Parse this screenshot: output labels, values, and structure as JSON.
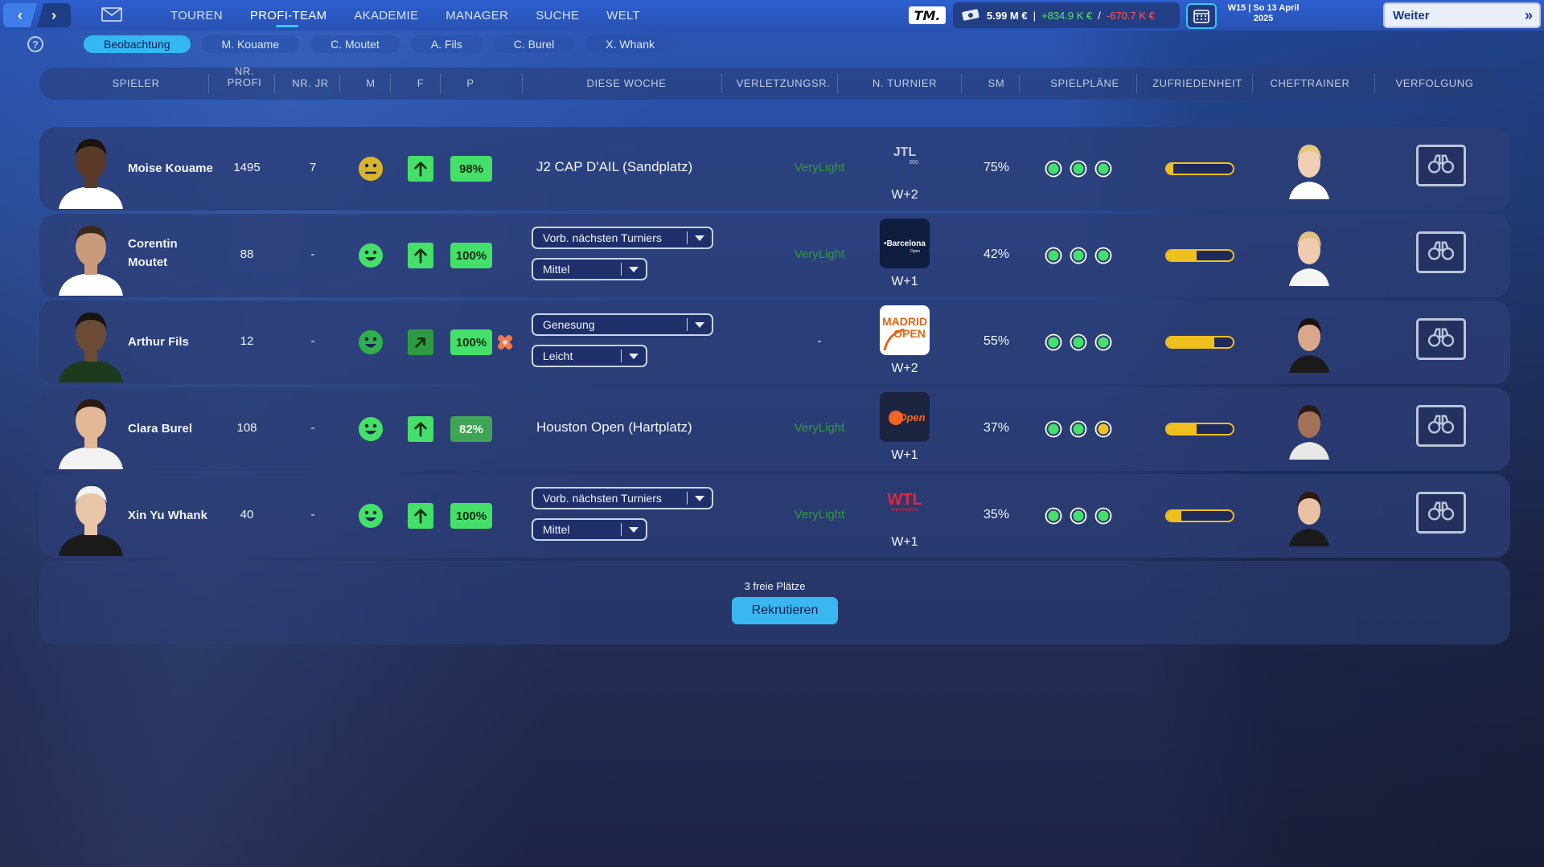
{
  "nav": {
    "back_label": "‹",
    "forward_label": "›",
    "items": [
      {
        "label": "TOUREN"
      },
      {
        "label": "PROFI-TEAM"
      },
      {
        "label": "AKADEMIE"
      },
      {
        "label": "MANAGER"
      },
      {
        "label": "SUCHE"
      },
      {
        "label": "WELT"
      }
    ],
    "active": "PROFI-TEAM"
  },
  "status": {
    "logo": "TM.",
    "balance": "5.99 M €",
    "separator": "|",
    "income": "+834.9 K €",
    "slash": "/",
    "expense": "-670.7 K €",
    "date_line1": "W15 | So 13 April",
    "date_line2": "2025",
    "continue_label": "Weiter",
    "continue_chevron": "»"
  },
  "help": "?",
  "subtabs": [
    {
      "label": "Beobachtung"
    },
    {
      "label": "M. Kouame"
    },
    {
      "label": "C. Moutet"
    },
    {
      "label": "A. Fils"
    },
    {
      "label": "C. Burel"
    },
    {
      "label": "X. Whank"
    }
  ],
  "columns": {
    "spieler": "SPIELER",
    "nr_profi": "NR.\nPROFI",
    "nr_jr": "NR. JR",
    "m": "M",
    "f": "F",
    "p": "P",
    "diese_woche": "DIESE WOCHE",
    "verletzung": "VERLETZUNGSR.",
    "turnier": "N. TURNIER",
    "sm": "SM",
    "spielplaene": "SPIELPLÄNE",
    "zufriedenheit": "ZUFRIEDENHEIT",
    "cheftrainer": "CHEFTRAINER",
    "verfolgung": "VERFOLGUNG"
  },
  "players": [
    {
      "name_line1": "Moise Kouame",
      "name_line2": "",
      "nr_profi": "1495",
      "nr_jr": "7",
      "mood": "neutral",
      "mood_color": "#d8b52a",
      "form": "up",
      "form_color": "#45e06a",
      "p": "98%",
      "p_dark": false,
      "injury_badge": false,
      "week_text": "J2 CAP D'AIL (Sandplatz)",
      "dd1": "",
      "dd2": "",
      "injury_risk": "VeryLight",
      "tournament_logo": "JTL 300",
      "tournament_week": "W+2",
      "sm": "75%",
      "schedule_dots": [
        "green",
        "green",
        "green"
      ],
      "satisfaction": 0.1
    },
    {
      "name_line1": "Corentin",
      "name_line2": "Moutet",
      "nr_profi": "88",
      "nr_jr": "-",
      "mood": "happy",
      "mood_color": "#45e06a",
      "form": "up",
      "form_color": "#45e06a",
      "p": "100%",
      "p_dark": false,
      "injury_badge": false,
      "week_text": "",
      "dd1": "Vorb. nächsten Turniers",
      "dd2": "Mittel",
      "injury_risk": "VeryLight",
      "tournament_logo": "Barcelona Open",
      "tournament_week": "W+1",
      "sm": "42%",
      "schedule_dots": [
        "green",
        "green",
        "green"
      ],
      "satisfaction": 0.45
    },
    {
      "name_line1": "Arthur Fils",
      "name_line2": "",
      "nr_profi": "12",
      "nr_jr": "-",
      "mood": "happy",
      "mood_color": "#2fb04a",
      "form": "up-right",
      "form_color": "#2f9a44",
      "p": "100%",
      "p_dark": false,
      "injury_badge": true,
      "week_text": "",
      "dd1": "Genesung",
      "dd2": "Leicht",
      "injury_risk": "-",
      "tournament_logo": "MADRID OPEN",
      "tournament_week": "W+2",
      "sm": "55%",
      "schedule_dots": [
        "green",
        "green",
        "green"
      ],
      "satisfaction": 0.72
    },
    {
      "name_line1": "Clara Burel",
      "name_line2": "",
      "nr_profi": "108",
      "nr_jr": "-",
      "mood": "happy",
      "mood_color": "#45e06a",
      "form": "up",
      "form_color": "#45e06a",
      "p": "82%",
      "p_dark": true,
      "injury_badge": false,
      "week_text": "Houston Open (Hartplatz)",
      "dd1": "",
      "dd2": "",
      "injury_risk": "VeryLight",
      "tournament_logo": "Open",
      "tournament_week": "W+1",
      "sm": "37%",
      "schedule_dots": [
        "green",
        "green",
        "yellow"
      ],
      "satisfaction": 0.45
    },
    {
      "name_line1": "Xin Yu Whank",
      "name_line2": "",
      "nr_profi": "40",
      "nr_jr": "-",
      "mood": "happy",
      "mood_color": "#45e06a",
      "form": "up",
      "form_color": "#45e06a",
      "p": "100%",
      "p_dark": false,
      "injury_badge": false,
      "week_text": "",
      "dd1": "Vorb. nächsten Turniers",
      "dd2": "Mittel",
      "injury_risk": "VeryLight",
      "tournament_logo": "WTL CONTINENTAL",
      "tournament_week": "W+1",
      "sm": "35%",
      "schedule_dots": [
        "green",
        "green",
        "green"
      ],
      "satisfaction": 0.22
    }
  ],
  "recruit": {
    "free_slots": "3 freie Plätze",
    "button_label": "Rekrutieren"
  }
}
